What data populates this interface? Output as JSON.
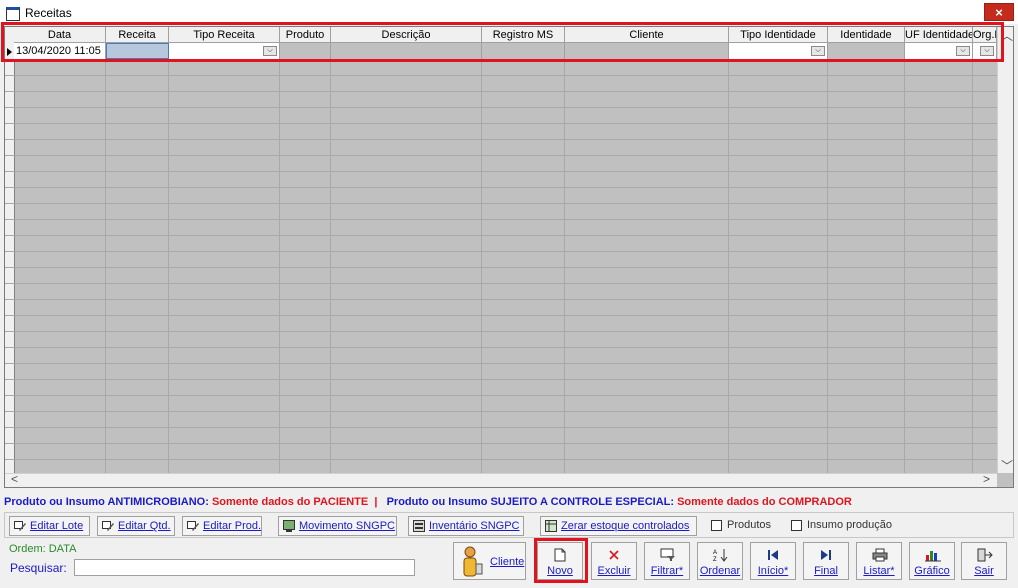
{
  "window": {
    "title": "Receitas",
    "close": "×"
  },
  "grid": {
    "columns": [
      "Data",
      "Receita",
      "Tipo Receita",
      "Produto",
      "Descrição",
      "Registro MS",
      "Cliente",
      "Tipo Identidade",
      "Identidade",
      "UF Identidade",
      "Org.E"
    ],
    "row": {
      "data": "13/04/2020 11:05",
      "receita": "",
      "tipo_receita": "",
      "produto": "",
      "descricao": "",
      "registro_ms": "",
      "cliente": "",
      "tipo_identidade": "",
      "identidade": "",
      "uf_identidade": "",
      "org": ""
    }
  },
  "info": {
    "part1": "Produto ou  Insumo ANTIMICROBIANO:",
    "part2": " Somente dados do PACIENTE",
    "sep": "  |  ",
    "part3": " Produto ou  Insumo SUJEITO A CONTROLE ESPECIAL:",
    "part4": " Somente dados do COMPRADOR"
  },
  "toolbar": {
    "editar_lote": "Editar Lote",
    "editar_qtd": "Editar Qtd.",
    "editar_prod": "Editar Prod.",
    "movimento": "Movimento SNGPC",
    "inventario": "Inventário SNGPC",
    "zerar": "Zerar estoque controlados",
    "produtos": "Produtos",
    "insumo": "Insumo produção"
  },
  "footer": {
    "ordem": "Ordem: DATA",
    "pesquisar_label": "Pesquisar:",
    "pesquisar_value": ""
  },
  "buttons": {
    "cliente": "Cliente",
    "novo": "Novo",
    "excluir": "Excluir",
    "filtrar": "Filtrar*",
    "ordenar": "Ordenar",
    "inicio": "Início*",
    "final": "Final",
    "listar": "Listar*",
    "grafico": "Gráfico",
    "sair": "Sair"
  }
}
